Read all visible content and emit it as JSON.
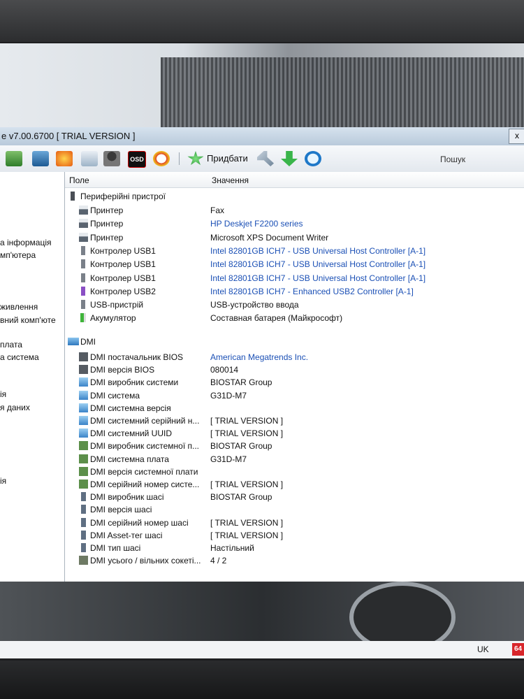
{
  "window": {
    "title": "e v7.00.6700  [ TRIAL VERSION ]",
    "close_glyph": "x"
  },
  "toolbar": {
    "add_label": "Придбати",
    "search_label": "Пошук",
    "osd_label": "OSD"
  },
  "left_panel": {
    "items": [
      "а інформація",
      "мп'ютера",
      "живлення",
      "вний комп'юте",
      "плата",
      "а система",
      "ія",
      "я даних",
      "ія"
    ]
  },
  "columns": {
    "field": "Поле",
    "value": "Значення"
  },
  "peripherals": {
    "category": "Периферійні пристрої",
    "rows": [
      {
        "field": "Принтер",
        "value": "Fax",
        "link": false,
        "icon": "printer-icon"
      },
      {
        "field": "Принтер",
        "value": "HP Deskjet F2200 series",
        "link": true,
        "icon": "printer-icon"
      },
      {
        "field": "Принтер",
        "value": "Microsoft XPS Document Writer",
        "link": false,
        "icon": "printer-icon"
      },
      {
        "field": "Контролер USB1",
        "value": "Intel 82801GB ICH7 - USB Universal Host Controller [A-1]",
        "link": true,
        "icon": "usb-icon"
      },
      {
        "field": "Контролер USB1",
        "value": "Intel 82801GB ICH7 - USB Universal Host Controller [A-1]",
        "link": true,
        "icon": "usb-icon"
      },
      {
        "field": "Контролер USB1",
        "value": "Intel 82801GB ICH7 - USB Universal Host Controller [A-1]",
        "link": true,
        "icon": "usb-icon"
      },
      {
        "field": "Контролер USB2",
        "value": "Intel 82801GB ICH7 - Enhanced USB2 Controller [A-1]",
        "link": true,
        "icon": "usb2-icon"
      },
      {
        "field": "USB-пристрій",
        "value": "USB-устройство ввода",
        "link": false,
        "icon": "usb-device-icon"
      },
      {
        "field": "Акумулятор",
        "value": "Составная батарея (Майкрософт)",
        "link": false,
        "icon": "battery-icon"
      }
    ]
  },
  "dmi": {
    "category": "DMI",
    "rows": [
      {
        "field": "DMI постачальник BIOS",
        "value": "American Megatrends Inc.",
        "link": true,
        "icon": "bios-chip-icon"
      },
      {
        "field": "DMI версія BIOS",
        "value": "080014",
        "link": false,
        "icon": "bios-chip-icon"
      },
      {
        "field": "DMI виробник системи",
        "value": "BIOSTAR Group",
        "link": false,
        "icon": "monitor-icon"
      },
      {
        "field": "DMI система",
        "value": "G31D-M7",
        "link": false,
        "icon": "monitor-icon"
      },
      {
        "field": "DMI системна версія",
        "value": "",
        "link": false,
        "icon": "monitor-icon"
      },
      {
        "field": "DMI системний серійний н...",
        "value": "[ TRIAL VERSION ]",
        "link": false,
        "icon": "monitor-icon"
      },
      {
        "field": "DMI системний UUID",
        "value": "[ TRIAL VERSION ]",
        "link": false,
        "icon": "monitor-icon"
      },
      {
        "field": "DMI виробник системної п...",
        "value": "BIOSTAR Group",
        "link": false,
        "icon": "motherboard-icon"
      },
      {
        "field": "DMI системна плата",
        "value": "G31D-M7",
        "link": false,
        "icon": "motherboard-icon"
      },
      {
        "field": "DMI версія системної плати",
        "value": "",
        "link": false,
        "icon": "motherboard-icon"
      },
      {
        "field": "DMI серійний номер систе...",
        "value": "[ TRIAL VERSION ]",
        "link": false,
        "icon": "motherboard-icon"
      },
      {
        "field": "DMI виробник шасі",
        "value": "BIOSTAR Group",
        "link": false,
        "icon": "chassis-icon"
      },
      {
        "field": "DMI версія шасі",
        "value": "",
        "link": false,
        "icon": "chassis-icon"
      },
      {
        "field": "DMI серійний номер шасі",
        "value": "[ TRIAL VERSION ]",
        "link": false,
        "icon": "chassis-icon"
      },
      {
        "field": "DMI Asset-тег шасі",
        "value": "[ TRIAL VERSION ]",
        "link": false,
        "icon": "chassis-icon"
      },
      {
        "field": "DMI тип шасі",
        "value": "Настільний",
        "link": false,
        "icon": "chassis-icon"
      },
      {
        "field": "DMI усього / вільних сокеті...",
        "value": "4 / 2",
        "link": false,
        "icon": "memory-slot-icon"
      }
    ]
  },
  "taskbar": {
    "language": "UK",
    "tray_badge": "64"
  },
  "colors": {
    "link": "#1a4fb5",
    "titlebar": "#c8d6e4",
    "wallpaper": "#c9cdd1"
  }
}
